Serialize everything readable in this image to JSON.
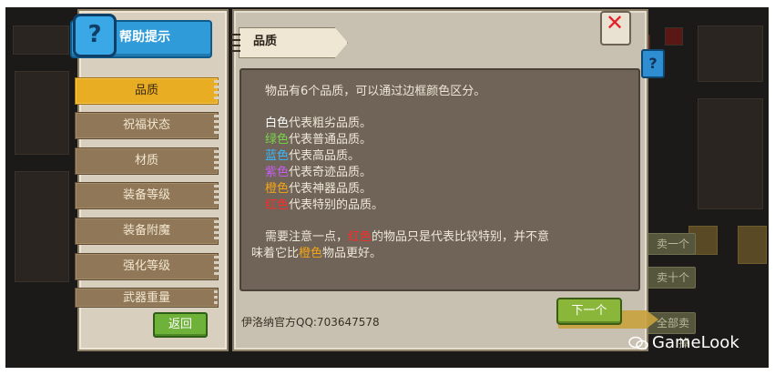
{
  "help": {
    "title": "帮助提示",
    "icon": "question-mark-icon"
  },
  "tabs": [
    {
      "label": "品质",
      "active": true
    },
    {
      "label": "祝福状态",
      "active": false
    },
    {
      "label": "材质",
      "active": false
    },
    {
      "label": "装备等级",
      "active": false
    },
    {
      "label": "装备附魔",
      "active": false
    },
    {
      "label": "强化等级",
      "active": false
    },
    {
      "label": "武器重量",
      "active": false
    }
  ],
  "back_label": "返回",
  "section": {
    "title": "品质"
  },
  "content": {
    "intro": "物品有6个品质，可以通过边框颜色区分。",
    "qualities": [
      {
        "color_name": "白色",
        "desc": "代表粗劣品质。",
        "color": "#ffffff"
      },
      {
        "color_name": "绿色",
        "desc": "代表普通品质。",
        "color": "#7ad34c"
      },
      {
        "color_name": "蓝色",
        "desc": "代表高品质。",
        "color": "#39b7ff"
      },
      {
        "color_name": "紫色",
        "desc": "代表奇迹品质。",
        "color": "#c75cf2"
      },
      {
        "color_name": "橙色",
        "desc": "代表神器品质。",
        "color": "#f5a418"
      },
      {
        "color_name": "红色",
        "desc": "代表特别的品质。",
        "color": "#ff2a2a"
      }
    ],
    "note": {
      "part1": "需要注意一点，",
      "red_word": "红色",
      "part2": "的物品只是代表比较特别，并不意",
      "part3": "味着它比",
      "orange_word": "橙色",
      "part4": "物品更好。"
    }
  },
  "contact": "伊洛纳官方QQ:703647578",
  "next_label": "下一个",
  "bg_buttons": [
    "卖一个",
    "卖十个",
    "全部卖掉"
  ],
  "close_icon": "close-x-icon",
  "watermark": "GameLook"
}
